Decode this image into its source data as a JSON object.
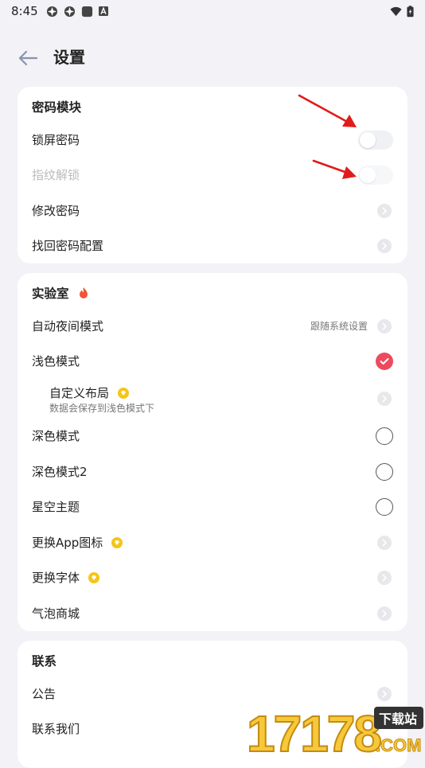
{
  "status_bar": {
    "time": "8:45"
  },
  "header": {
    "title": "设置"
  },
  "password_section": {
    "title": "密码模块",
    "items": [
      {
        "label": "锁屏密码"
      },
      {
        "label": "指纹解锁"
      },
      {
        "label": "修改密码"
      },
      {
        "label": "找回密码配置"
      }
    ]
  },
  "lab_section": {
    "title": "实验室",
    "auto_night": {
      "label": "自动夜间模式",
      "value": "跟随系统设置"
    },
    "light_mode": {
      "label": "浅色模式"
    },
    "custom_layout": {
      "label": "自定义布局",
      "desc": "数据会保存到浅色模式下"
    },
    "dark_mode": {
      "label": "深色模式"
    },
    "dark_mode2": {
      "label": "深色模式2"
    },
    "starry": {
      "label": "星空主题"
    },
    "app_icon": {
      "label": "更换App图标"
    },
    "font": {
      "label": "更换字体"
    },
    "bubble_store": {
      "label": "气泡商城"
    }
  },
  "contact_section": {
    "title": "联系",
    "items": [
      {
        "label": "公告"
      },
      {
        "label": "联系我们"
      }
    ]
  },
  "watermark": {
    "text": "17178",
    "sub": "下载站",
    "domain": ".COM"
  },
  "colors": {
    "accent": "#ee4a5e",
    "background": "#f2f2f7",
    "arrow": "#e11b1b",
    "gem": "#f5c518",
    "fire": "#f2553a"
  }
}
